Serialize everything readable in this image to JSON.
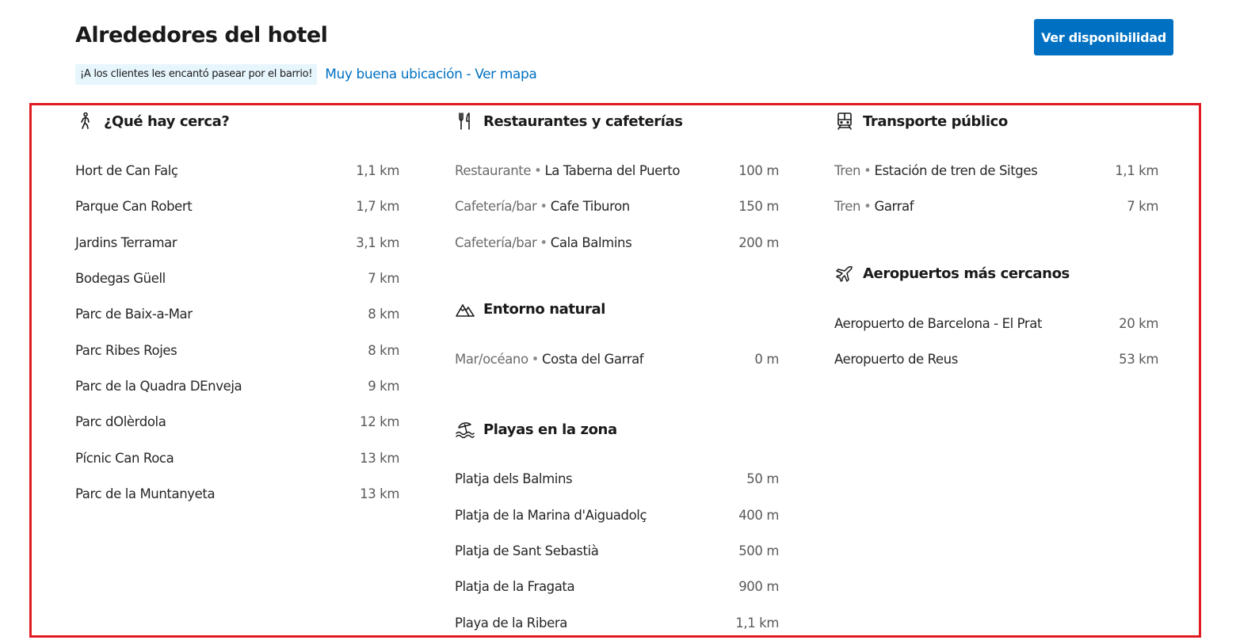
{
  "header": {
    "title": "Alrededores del hotel",
    "cta_label": "Ver disponibilidad",
    "praise_badge": "¡A los clientes les encantó pasear por el barrio!",
    "map_link": "Muy buena ubicación - Ver mapa"
  },
  "colors": {
    "accent": "#0071c2",
    "badge_bg": "#e7f6fd",
    "highlight_frame": "#e11b22"
  },
  "sections": {
    "nearby": {
      "icon": "walking-person-icon",
      "title": "¿Qué hay cerca?",
      "items": [
        {
          "name": "Hort de Can Falç",
          "distance": "1,1 km"
        },
        {
          "name": "Parque Can Robert",
          "distance": "1,7 km"
        },
        {
          "name": "Jardins Terramar",
          "distance": "3,1 km"
        },
        {
          "name": "Bodegas Güell",
          "distance": "7 km"
        },
        {
          "name": "Parc de Baix-a-Mar",
          "distance": "8 km"
        },
        {
          "name": "Parc Ribes Rojes",
          "distance": "8 km"
        },
        {
          "name": "Parc de la Quadra DEnveja",
          "distance": "9 km"
        },
        {
          "name": "Parc dOlèrdola",
          "distance": "12 km"
        },
        {
          "name": "Pícnic Can Roca",
          "distance": "13 km"
        },
        {
          "name": "Parc de la Muntanyeta",
          "distance": "13 km"
        }
      ]
    },
    "restaurants": {
      "icon": "cutlery-icon",
      "title": "Restaurantes y cafeterías",
      "items": [
        {
          "category": "Restaurante",
          "name": "La Taberna del Puerto",
          "distance": "100 m"
        },
        {
          "category": "Cafetería/bar",
          "name": "Cafe Tiburon",
          "distance": "150 m"
        },
        {
          "category": "Cafetería/bar",
          "name": "Cala Balmins",
          "distance": "200 m"
        }
      ]
    },
    "nature": {
      "icon": "mountain-icon",
      "title": "Entorno natural",
      "items": [
        {
          "category": "Mar/océano",
          "name": "Costa del Garraf",
          "distance": "0 m"
        }
      ]
    },
    "beaches": {
      "icon": "beach-umbrella-icon",
      "title": "Playas en la zona",
      "items": [
        {
          "name": "Platja dels Balmins",
          "distance": "50 m"
        },
        {
          "name": "Platja de la Marina d'Aiguadolç",
          "distance": "400 m"
        },
        {
          "name": "Platja de Sant Sebastià",
          "distance": "500 m"
        },
        {
          "name": "Platja de la Fragata",
          "distance": "900 m"
        },
        {
          "name": "Playa de la Ribera",
          "distance": "1,1 km"
        }
      ]
    },
    "transport": {
      "icon": "train-icon",
      "title": "Transporte público",
      "items": [
        {
          "category": "Tren",
          "name": "Estación de tren de Sitges",
          "distance": "1,1 km"
        },
        {
          "category": "Tren",
          "name": "Garraf",
          "distance": "7 km"
        }
      ]
    },
    "airports": {
      "icon": "airplane-icon",
      "title": "Aeropuertos más cercanos",
      "items": [
        {
          "name": "Aeropuerto de Barcelona - El Prat",
          "distance": "20 km"
        },
        {
          "name": "Aeropuerto de Reus",
          "distance": "53 km"
        }
      ]
    }
  }
}
